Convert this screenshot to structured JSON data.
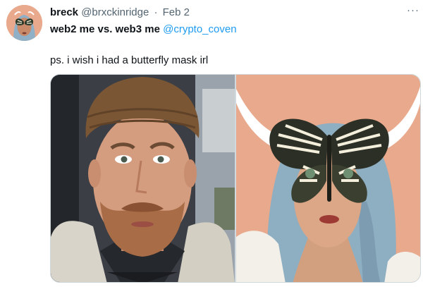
{
  "tweet": {
    "display_name": "breck",
    "handle": "@brxckinridge",
    "separator": "·",
    "date": "Feb 2",
    "more_label": "···",
    "text_line1_main": "web2 me vs. web3 me",
    "mention": "@crypto_coven",
    "text_line2": "ps. i wish i had a butterfly mask irl"
  },
  "icons": {
    "more": "more-horizontal-icon",
    "avatar": "butterfly-mask-avatar"
  },
  "colors": {
    "link": "#1d9bf0",
    "secondary_text": "#536471",
    "primary_text": "#0f1419",
    "border": "#cfd9de",
    "illustration_bg": "#e9a98c"
  }
}
